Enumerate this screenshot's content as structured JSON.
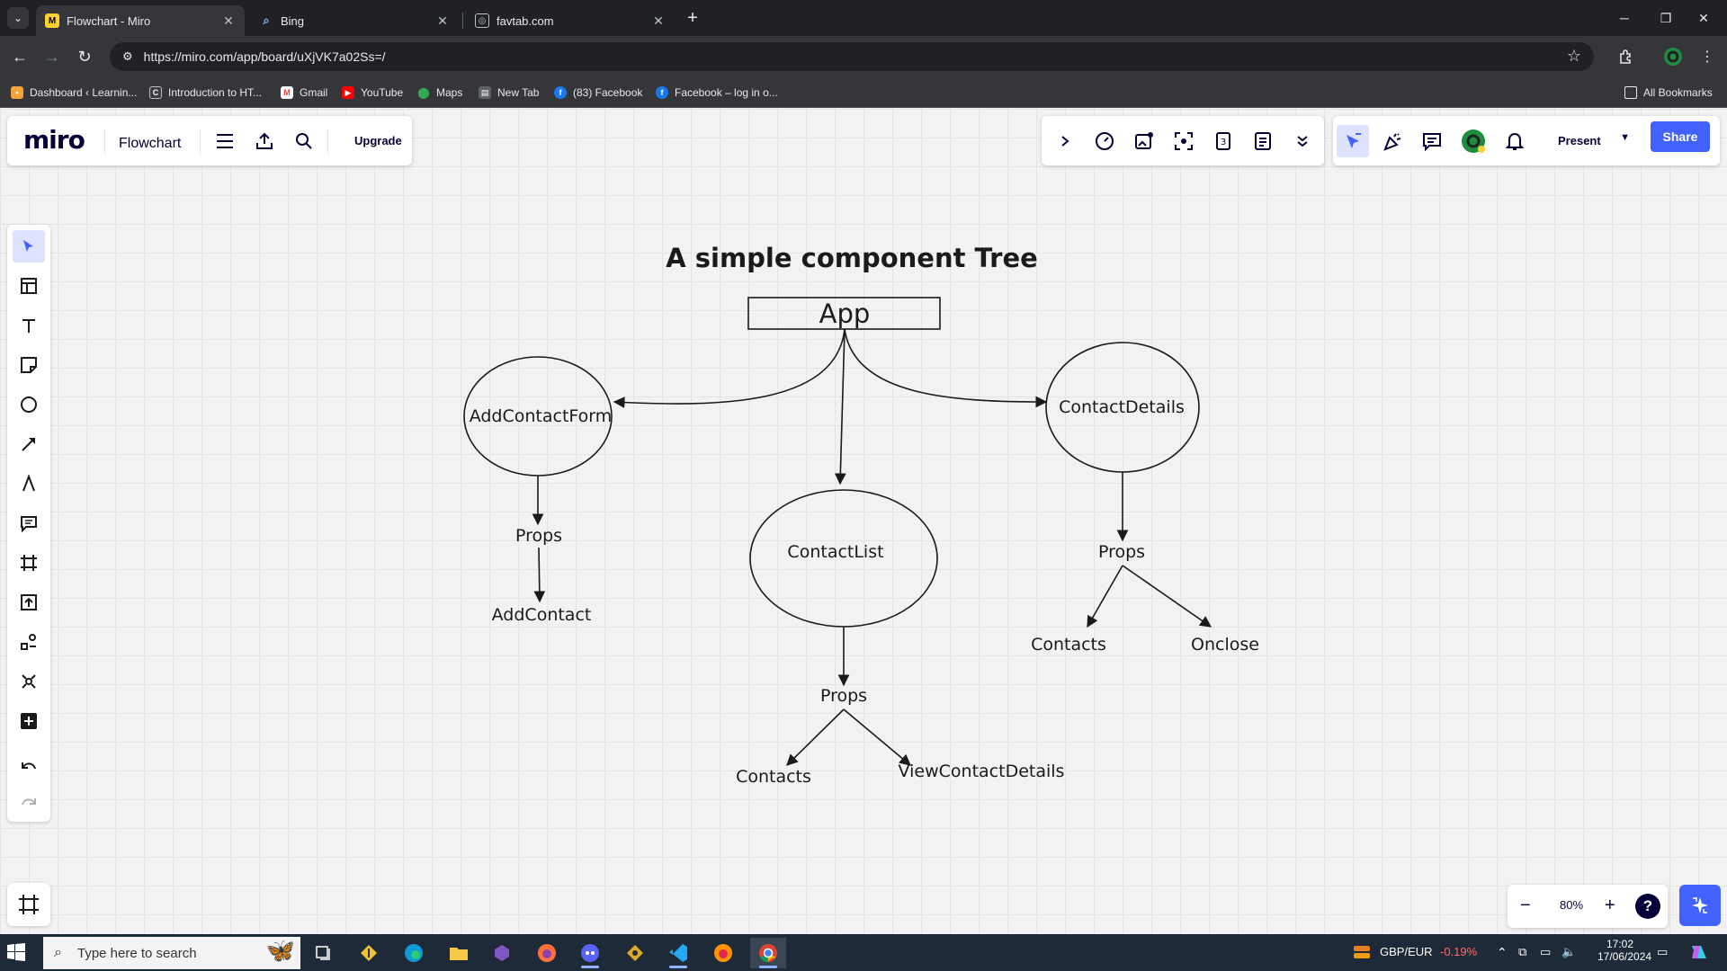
{
  "browser": {
    "tabs": [
      {
        "title": "Flowchart - Miro",
        "favicon": "miro-favicon",
        "active": true
      },
      {
        "title": "Bing",
        "favicon": "search-favicon",
        "active": false
      },
      {
        "title": "favtab.com",
        "favicon": "globe-favicon",
        "active": false
      }
    ],
    "url": "https://miro.com/app/board/uXjVK7a02Ss=/",
    "bookmarks": [
      {
        "label": "Dashboard ‹ Learnin...",
        "icon": "folder-yellow-icon"
      },
      {
        "label": "Introduction to HT...",
        "icon": "codecademy-icon"
      },
      {
        "label": "Gmail",
        "icon": "gmail-icon"
      },
      {
        "label": "YouTube",
        "icon": "youtube-icon"
      },
      {
        "label": "Maps",
        "icon": "maps-pin-icon"
      },
      {
        "label": "New Tab",
        "icon": "page-icon"
      },
      {
        "label": "(83) Facebook",
        "icon": "facebook-icon"
      },
      {
        "label": "Facebook – log in o...",
        "icon": "facebook-icon"
      }
    ],
    "all_bookmarks_label": "All Bookmarks"
  },
  "miro": {
    "logo": "miro",
    "board_name": "Flowchart",
    "upgrade_label": "Upgrade",
    "present_label": "Present",
    "share_label": "Share",
    "zoom_level": "80%",
    "help_label": "?"
  },
  "diagram": {
    "title": "A simple component Tree",
    "app_label": "App",
    "add_contact_form": "AddContactForm",
    "contact_list": "ContactList",
    "contact_details": "ContactDetails",
    "props_left": "Props",
    "add_contact": "AddContact",
    "props_middle": "Props",
    "contacts_middle": "Contacts",
    "view_contact_details": "ViewContactDetails",
    "props_right": "Props",
    "contacts_right": "Contacts",
    "onclose": "Onclose"
  },
  "taskbar": {
    "search_placeholder": "Type here to search",
    "ticker_pair": "GBP/EUR",
    "ticker_change": "-0.19%",
    "time": "17:02",
    "date": "17/06/2024"
  },
  "colors": {
    "accent": "#4262ff",
    "ticker_negative": "#ff6b6b",
    "miro_yellow": "#ffd02f"
  }
}
